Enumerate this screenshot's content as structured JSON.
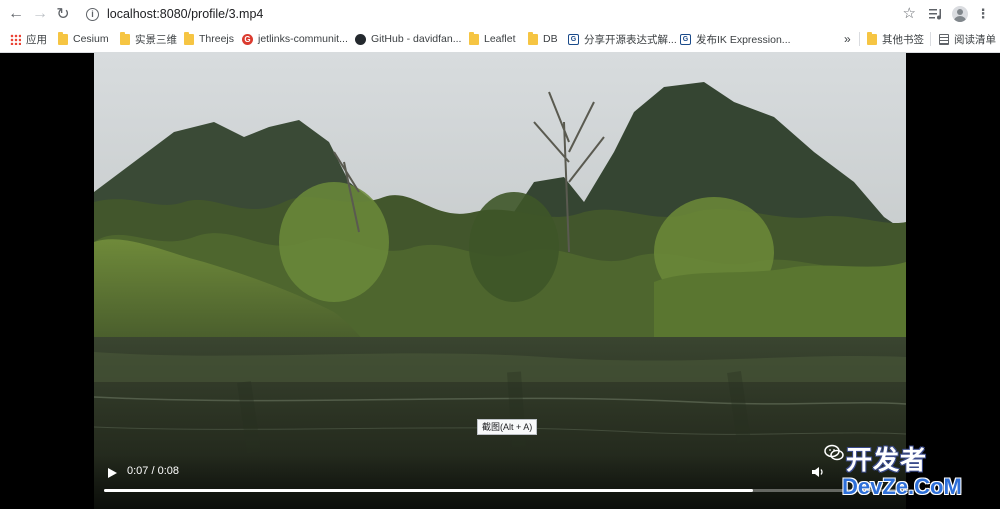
{
  "browser": {
    "url": "localhost:8080/profile/3.mp4"
  },
  "bookmarks": [
    {
      "label": "应用",
      "icon": "apps-grid-icon"
    },
    {
      "label": "Cesium",
      "icon": "folder-icon"
    },
    {
      "label": "实景三维",
      "icon": "folder-icon"
    },
    {
      "label": "Threejs",
      "icon": "folder-icon"
    },
    {
      "label": "jetlinks-communit...",
      "icon": "gitee-icon"
    },
    {
      "label": "GitHub - davidfan...",
      "icon": "github-icon"
    },
    {
      "label": "Leaflet",
      "icon": "folder-icon"
    },
    {
      "label": "DB",
      "icon": "folder-icon"
    },
    {
      "label": "分享开源表达式解...",
      "icon": "site-icon"
    },
    {
      "label": "发布IK Expression...",
      "icon": "site-icon"
    }
  ],
  "bookmarks_overflow": "»",
  "other_bookmarks": "其他书签",
  "reading_list": "阅读清单",
  "video": {
    "time": "0:07 / 0:08",
    "progress": 0.82
  },
  "tooltip": "截图(Alt + A)",
  "watermark": {
    "cn": "开发者",
    "en": "DevZe.CoM"
  },
  "colors": {
    "progress_fill": "#ffffff",
    "watermark_blue": "#2e6fd8"
  }
}
